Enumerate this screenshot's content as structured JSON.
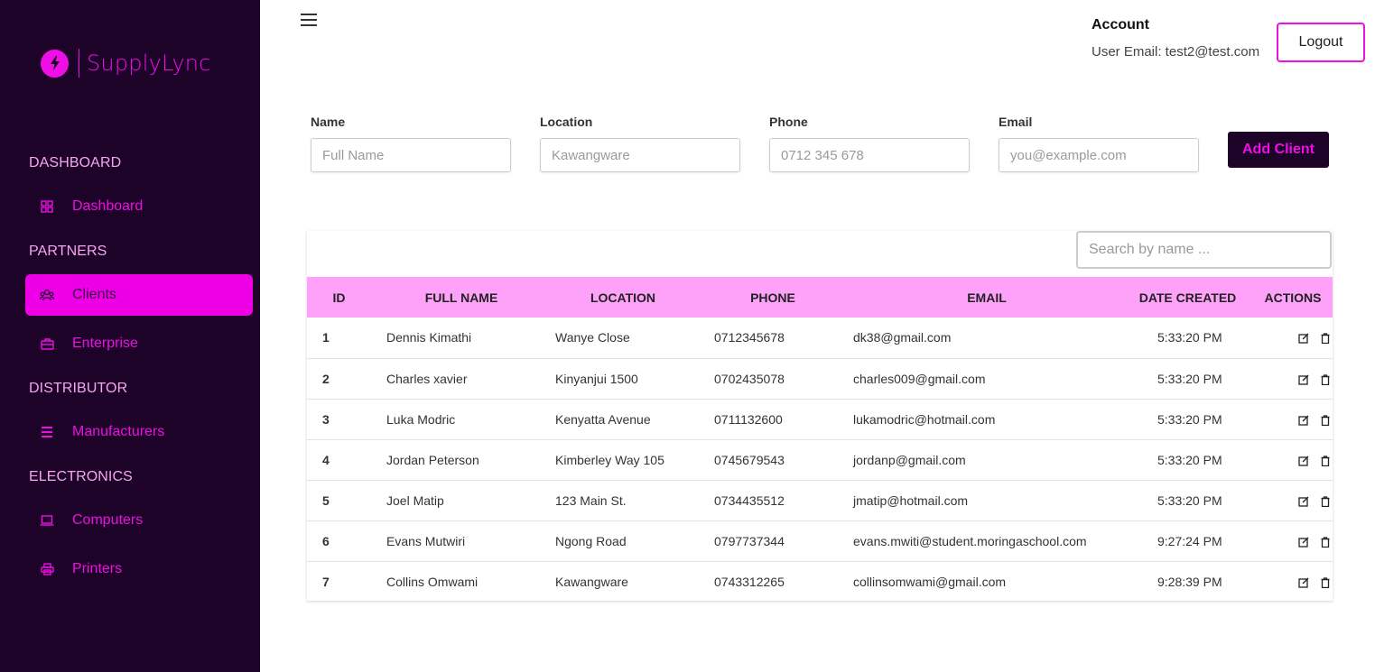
{
  "brand": {
    "name": "SupplyLync",
    "accent": "#ee0ee6",
    "sidebar_bg": "#1d0328"
  },
  "sidebar": {
    "sections": [
      {
        "title": "DASHBOARD",
        "items": [
          {
            "label": "Dashboard",
            "icon": "dashboard-icon"
          }
        ]
      },
      {
        "title": "PARTNERS",
        "items": [
          {
            "label": "Clients",
            "icon": "clients-icon",
            "active": true
          },
          {
            "label": "Enterprise",
            "icon": "briefcase-icon"
          }
        ]
      },
      {
        "title": "DISTRIBUTOR",
        "items": [
          {
            "label": "Manufacturers",
            "icon": "list-icon"
          }
        ]
      },
      {
        "title": "ELECTRONICS",
        "items": [
          {
            "label": "Computers",
            "icon": "laptop-icon"
          },
          {
            "label": "Printers",
            "icon": "printer-icon"
          }
        ]
      }
    ]
  },
  "header": {
    "account_title": "Account",
    "account_email": "User Email: test2@test.com",
    "logout_label": "Logout"
  },
  "form": {
    "name": {
      "label": "Name",
      "placeholder": "Full Name"
    },
    "location": {
      "label": "Location",
      "placeholder": "Kawangware"
    },
    "phone": {
      "label": "Phone",
      "placeholder": "0712 345 678"
    },
    "email": {
      "label": "Email",
      "placeholder": "you@example.com"
    },
    "submit_label": "Add Client"
  },
  "table": {
    "search_placeholder": "Search by name ...",
    "columns": [
      "ID",
      "FULL NAME",
      "LOCATION",
      "PHONE",
      "EMAIL",
      "DATE CREATED",
      "ACTIONS"
    ],
    "rows": [
      {
        "id": "1",
        "name": "Dennis Kimathi",
        "location": "Wanye Close",
        "phone": "0712345678",
        "email": "dk38@gmail.com",
        "created": "5:33:20 PM"
      },
      {
        "id": "2",
        "name": "Charles xavier",
        "location": "Kinyanjui 1500",
        "phone": "0702435078",
        "email": "charles009@gmail.com",
        "created": "5:33:20 PM"
      },
      {
        "id": "3",
        "name": "Luka Modric",
        "location": "Kenyatta Avenue",
        "phone": "0711132600",
        "email": "lukamodric@hotmail.com",
        "created": "5:33:20 PM"
      },
      {
        "id": "4",
        "name": "Jordan Peterson",
        "location": "Kimberley Way 105",
        "phone": "0745679543",
        "email": "jordanp@gmail.com",
        "created": "5:33:20 PM"
      },
      {
        "id": "5",
        "name": "Joel Matip",
        "location": "123 Main St.",
        "phone": "0734435512",
        "email": "jmatip@hotmail.com",
        "created": "5:33:20 PM"
      },
      {
        "id": "6",
        "name": "Evans Mutwiri",
        "location": "Ngong Road",
        "phone": "0797737344",
        "email": "evans.mwiti@student.moringaschool.com",
        "created": "9:27:24 PM"
      },
      {
        "id": "7",
        "name": "Collins Omwami",
        "location": "Kawangware",
        "phone": "0743312265",
        "email": "collinsomwami@gmail.com",
        "created": "9:28:39 PM"
      }
    ]
  }
}
